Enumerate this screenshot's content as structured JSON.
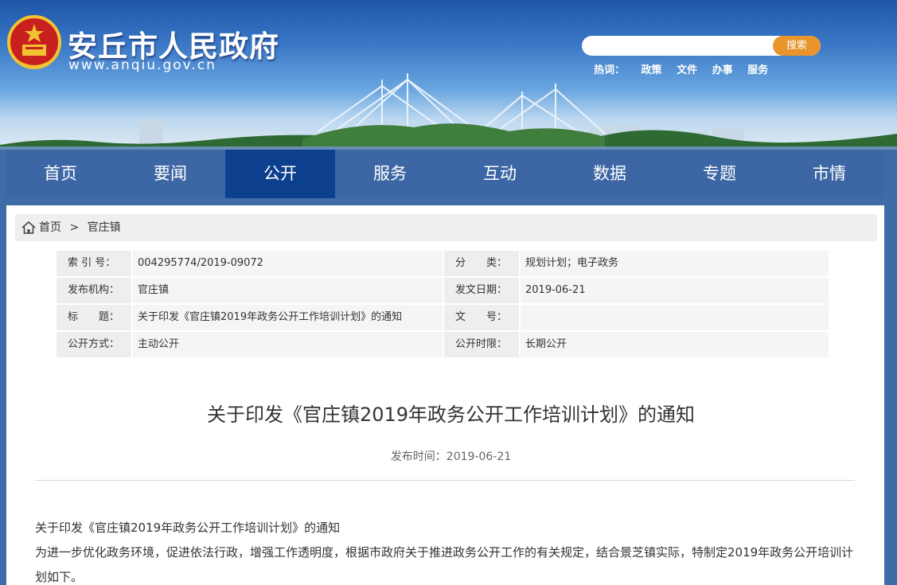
{
  "header": {
    "site_title": "安丘市人民政府",
    "site_domain": "www.anqiu.gov.cn",
    "search_placeholder": "",
    "search_button": "搜索",
    "hot_label": "热词：",
    "hot_words": [
      "政策",
      "文件",
      "办事",
      "服务"
    ]
  },
  "nav": {
    "items": [
      "首页",
      "要闻",
      "公开",
      "服务",
      "互动",
      "数据",
      "专题",
      "市情"
    ],
    "active": "公开"
  },
  "breadcrumb": {
    "home": "首页",
    "separator": ">",
    "current": "官庄镇"
  },
  "meta": {
    "rows": [
      {
        "l_label": "索 引 号：",
        "l_value": "004295774/2019-09072",
        "r_label": "分　　类：",
        "r_value": "规划计划；电子政务"
      },
      {
        "l_label": "发布机构：",
        "l_value": "官庄镇",
        "r_label": "发文日期：",
        "r_value": "2019-06-21"
      },
      {
        "l_label": "标　　题：",
        "l_value": "关于印发《官庄镇2019年政务公开工作培训计划》的通知",
        "r_label": "文　　号：",
        "r_value": ""
      },
      {
        "l_label": "公开方式：",
        "l_value": "主动公开",
        "r_label": "公开时限：",
        "r_value": "长期公开"
      }
    ]
  },
  "article": {
    "title": "关于印发《官庄镇2019年政务公开工作培训计划》的通知",
    "publish_time": "发布时间：2019-06-21",
    "paragraphs": [
      "关于印发《官庄镇2019年政务公开工作培训计划》的通知",
      "为进一步优化政务环境，促进依法行政，增强工作透明度，根据市政府关于推进政务公开工作的有关规定，结合景芝镇实际，特制定2019年政务公开培训计划如下。"
    ]
  },
  "colors": {
    "nav_bg": "#3d67a4",
    "nav_active": "#0d3f8f",
    "search_btn": "#e9952c"
  }
}
